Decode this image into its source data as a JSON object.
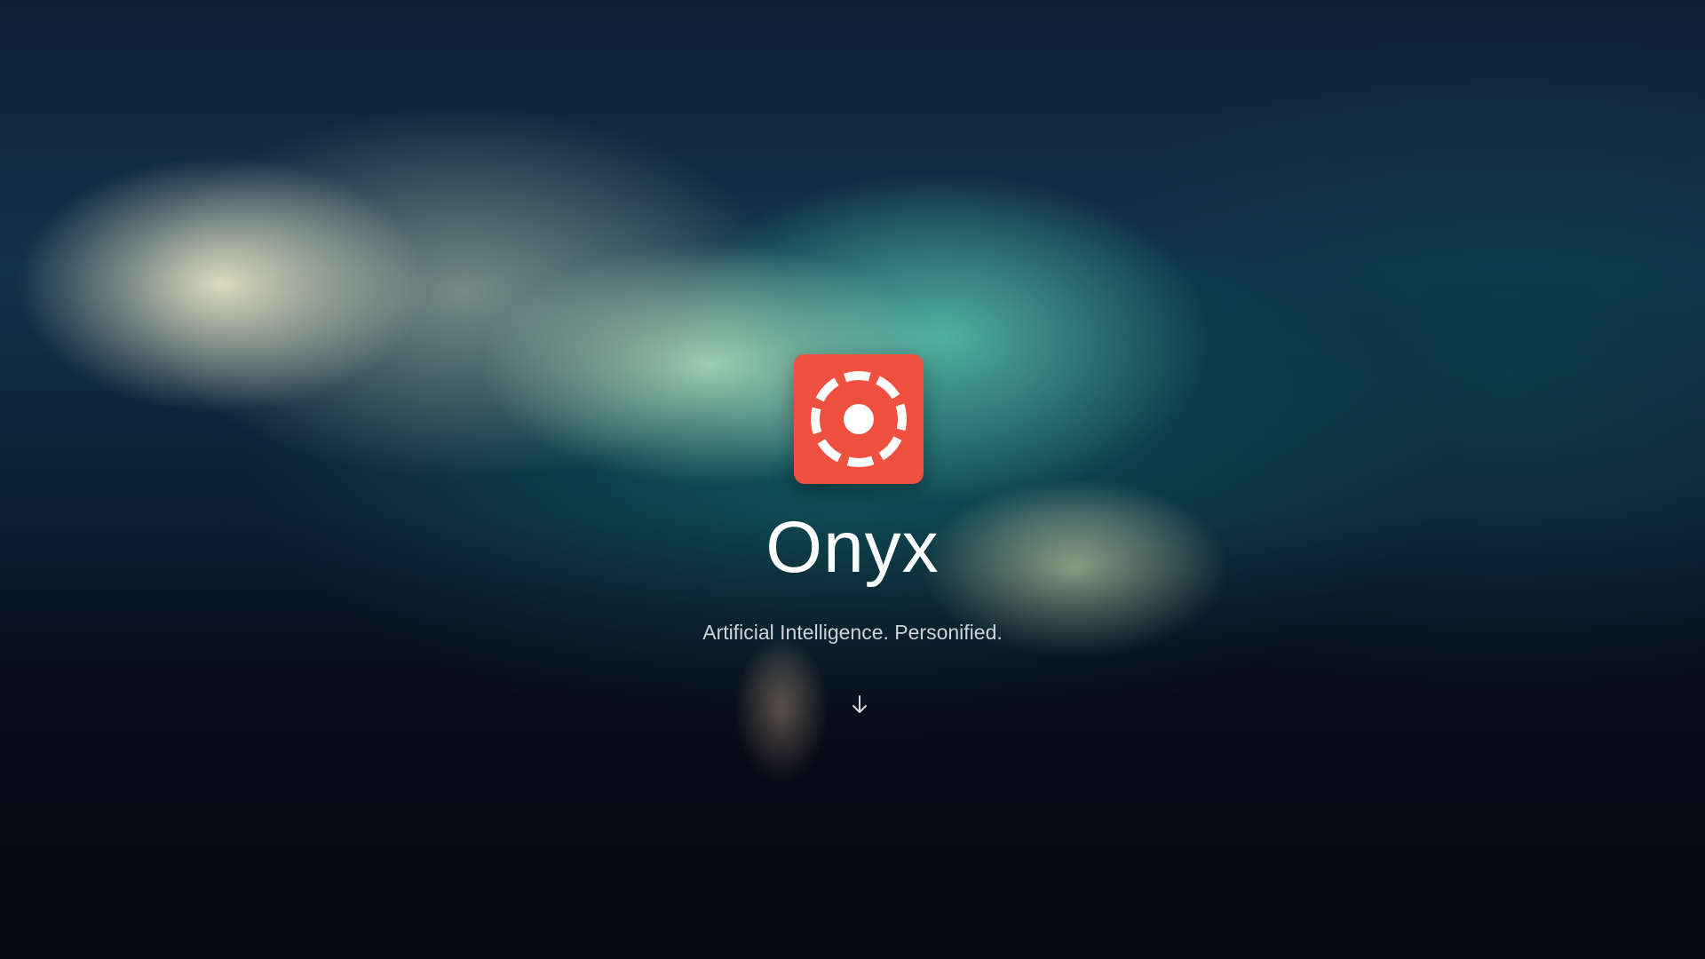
{
  "brand": {
    "name": "Onyx",
    "tagline": "Artificial Intelligence. Personified.",
    "logo_icon": "target-ring-icon",
    "logo_color": "#f0503f"
  },
  "actions": {
    "scroll_icon": "arrow-down-icon"
  }
}
